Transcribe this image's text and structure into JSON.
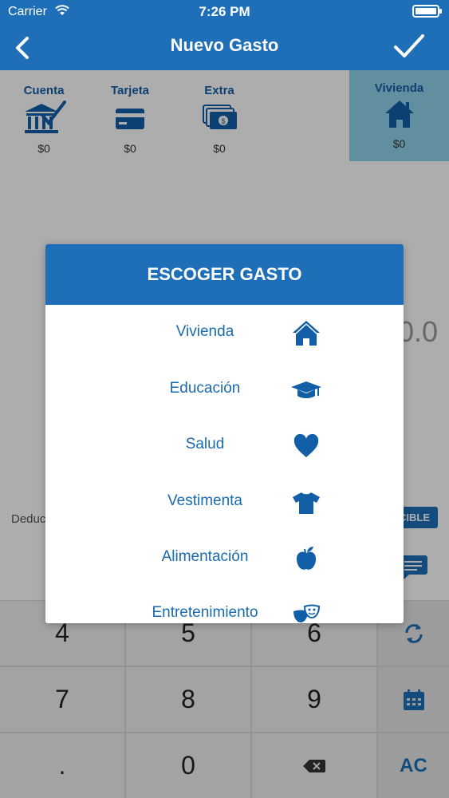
{
  "status_bar": {
    "carrier": "Carrier",
    "time": "7:26 PM"
  },
  "nav": {
    "title": "Nuevo Gasto",
    "back_icon": "chevron-left-icon",
    "done_icon": "checkmark-icon"
  },
  "accounts": [
    {
      "label": "Cuenta",
      "amount": "$0",
      "icon": "bank-check-icon"
    },
    {
      "label": "Tarjeta",
      "amount": "$0",
      "icon": "credit-card-icon"
    },
    {
      "label": "Extra",
      "amount": "$0",
      "icon": "cash-icon"
    },
    {
      "label": "Vivienda",
      "amount": "$0",
      "icon": "house-icon",
      "selected": true
    }
  ],
  "amount_partial": "0.0",
  "deductible_label_partial": "Deduc",
  "deductible_button_partial": "CIBLE",
  "keypad": {
    "keys": [
      "4",
      "5",
      "6",
      "7",
      "8",
      "9",
      ".",
      "0"
    ],
    "backspace_icon": "backspace-icon",
    "memo_icon": "chat-bubble-icon",
    "repeat_icon": "refresh-icon",
    "calendar_icon": "calendar-icon",
    "clear_label": "AC"
  },
  "dialog": {
    "title": "ESCOGER GASTO",
    "options": [
      {
        "label": "Vivienda",
        "icon": "house-icon"
      },
      {
        "label": "Educación",
        "icon": "graduation-cap-icon"
      },
      {
        "label": "Salud",
        "icon": "heart-icon"
      },
      {
        "label": "Vestimenta",
        "icon": "tshirt-icon"
      },
      {
        "label": "Alimentación",
        "icon": "apple-icon"
      },
      {
        "label": "Entretenimiento",
        "icon": "theater-masks-icon"
      }
    ]
  },
  "colors": {
    "primary": "#1e6fb8",
    "selected_tab": "#8fd3ea",
    "option_text": "#1a6aae"
  }
}
